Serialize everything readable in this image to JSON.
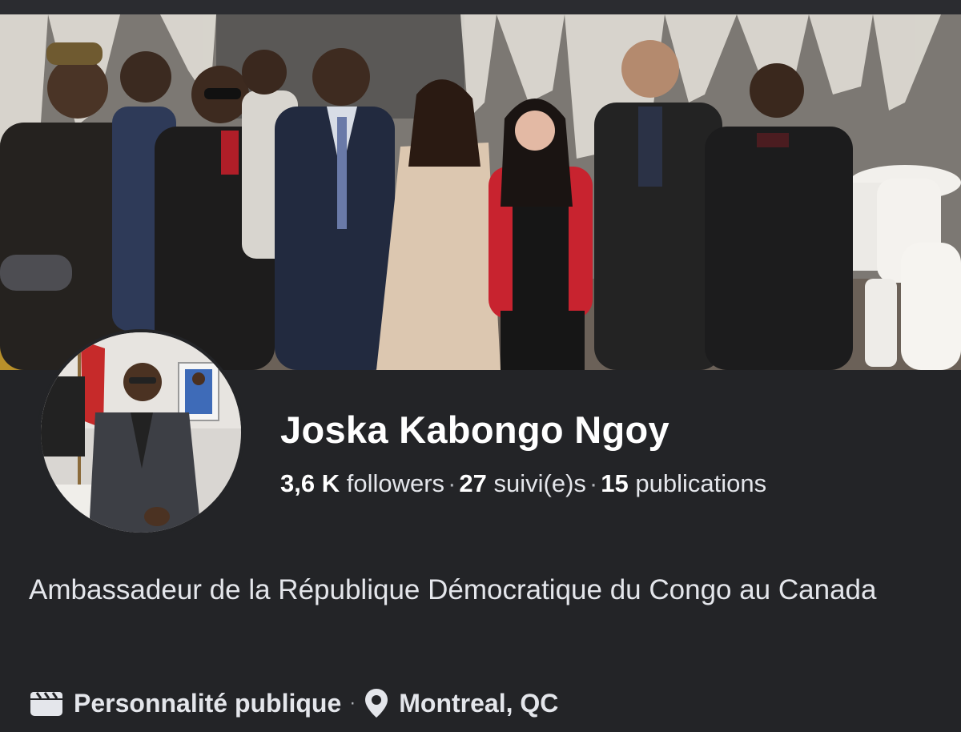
{
  "profile": {
    "name": "Joska Kabongo Ngoy",
    "stats": {
      "followers_value": "3,6 K",
      "followers_label": "followers",
      "following_value": "27",
      "following_label": "suivi(e)s",
      "posts_value": "15",
      "posts_label": "publications",
      "separator": "·"
    },
    "bio": "Ambassadeur de la République Démocratique du Congo au Canada",
    "category": "Personnalité publique",
    "location": "Montreal, QC",
    "category_icon": "clapperboard-icon",
    "location_icon": "map-pin-icon"
  },
  "colors": {
    "background": "#232427",
    "text_primary": "#ffffff",
    "text_secondary": "#e4e6eb"
  }
}
